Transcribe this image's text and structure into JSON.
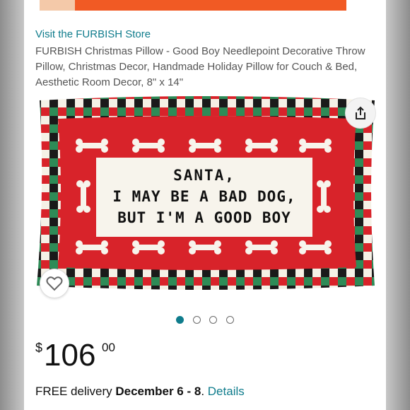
{
  "store": {
    "link_text": "Visit the FURBISH Store"
  },
  "product": {
    "title": "FURBISH Christmas Pillow - Good Boy Needlepoint Decorative Throw Pillow, Christmas Decor, Handmade Holiday Pillow for Couch & Bed, Aesthetic Room Decor, 8\" x 14\"",
    "pillow_text": [
      "SANTA,",
      "I MAY BE A BAD DOG,",
      "BUT I'M A GOOD BOY"
    ]
  },
  "gallery": {
    "image_count": 4,
    "active_index": 0
  },
  "price": {
    "currency": "$",
    "whole": "106",
    "fraction": "00"
  },
  "delivery": {
    "prefix": "FREE delivery ",
    "date": "December 6 - 8",
    "separator": ". ",
    "link": "Details"
  },
  "colors": {
    "link": "#0f7c8c",
    "pillow_red": "#d8232a",
    "pillow_green": "#2e8b57",
    "banner": "#f15a24"
  },
  "icons": {
    "share": "share-icon",
    "wishlist": "heart-icon"
  }
}
